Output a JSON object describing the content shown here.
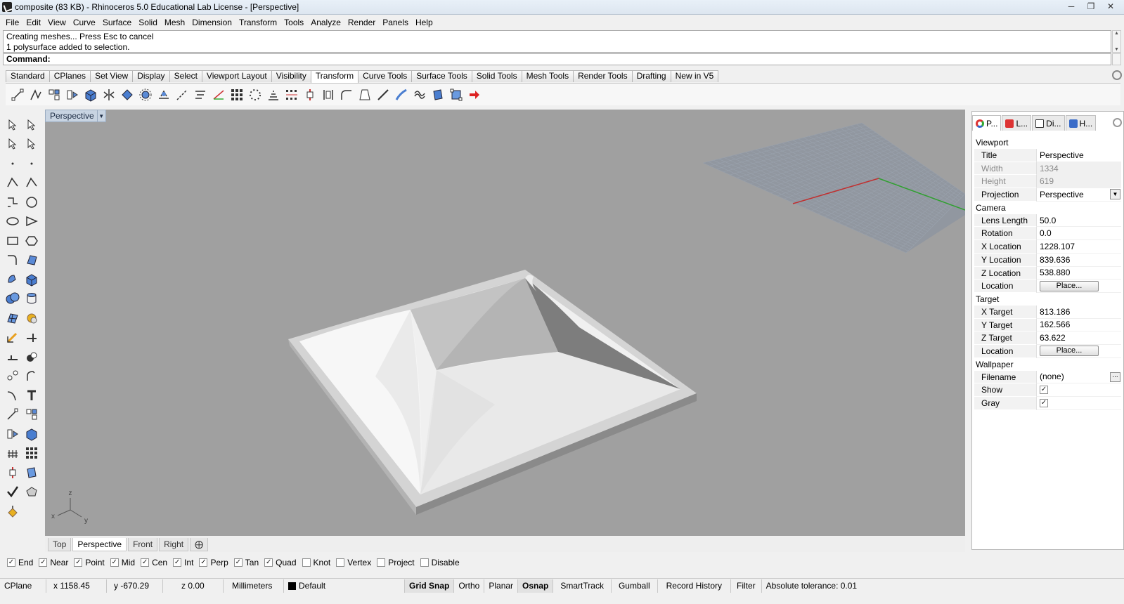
{
  "window": {
    "title": "composite (83 KB) - Rhinoceros 5.0 Educational Lab License - [Perspective]",
    "controls": [
      "minimize-icon",
      "maximize-icon",
      "close-icon"
    ]
  },
  "menu": [
    "File",
    "Edit",
    "View",
    "Curve",
    "Surface",
    "Solid",
    "Mesh",
    "Dimension",
    "Transform",
    "Tools",
    "Analyze",
    "Render",
    "Panels",
    "Help"
  ],
  "command": {
    "history": [
      "Creating meshes... Press Esc to cancel",
      "1 polysurface added to selection."
    ],
    "prompt": "Command:"
  },
  "toolbar_tabs": {
    "items": [
      "Standard",
      "CPlanes",
      "Set View",
      "Display",
      "Select",
      "Viewport Layout",
      "Visibility",
      "Transform",
      "Curve Tools",
      "Surface Tools",
      "Solid Tools",
      "Mesh Tools",
      "Render Tools",
      "Drafting",
      "New in V5"
    ],
    "active": "Transform"
  },
  "viewport": {
    "name": "Perspective",
    "axis_labels": {
      "x": "x",
      "y": "y",
      "z": "z"
    },
    "tabs": [
      "Top",
      "Perspective",
      "Front",
      "Right"
    ],
    "active_tab": "Perspective",
    "background": "#a0a0a0"
  },
  "osnap": [
    {
      "label": "End",
      "checked": true
    },
    {
      "label": "Near",
      "checked": true
    },
    {
      "label": "Point",
      "checked": true
    },
    {
      "label": "Mid",
      "checked": true
    },
    {
      "label": "Cen",
      "checked": true
    },
    {
      "label": "Int",
      "checked": true
    },
    {
      "label": "Perp",
      "checked": true
    },
    {
      "label": "Tan",
      "checked": true
    },
    {
      "label": "Quad",
      "checked": true
    },
    {
      "label": "Knot",
      "checked": false
    },
    {
      "label": "Vertex",
      "checked": false
    },
    {
      "label": "Project",
      "checked": false
    },
    {
      "label": "Disable",
      "checked": false
    }
  ],
  "status": {
    "cplane": "CPlane",
    "x": "x 1158.45",
    "y": "y -670.29",
    "z": "z 0.00",
    "units": "Millimeters",
    "layer": "Default",
    "grid_snap": "Grid Snap",
    "ortho": "Ortho",
    "planar": "Planar",
    "osnap": "Osnap",
    "smarttrack": "SmartTrack",
    "gumball": "Gumball",
    "record_history": "Record History",
    "filter": "Filter",
    "tolerance": "Absolute tolerance: 0.01"
  },
  "panel": {
    "tabs": [
      "P...",
      "L...",
      "Di...",
      "H..."
    ],
    "viewport_section": "Viewport",
    "title_label": "Title",
    "title_value": "Perspective",
    "width_label": "Width",
    "width_value": "1334",
    "height_label": "Height",
    "height_value": "619",
    "projection_label": "Projection",
    "projection_value": "Perspective",
    "camera_section": "Camera",
    "lens_label": "Lens Length",
    "lens_value": "50.0",
    "rotation_label": "Rotation",
    "rotation_value": "0.0",
    "xloc_label": "X Location",
    "xloc_value": "1228.107",
    "yloc_label": "Y Location",
    "yloc_value": "839.636",
    "zloc_label": "Z Location",
    "zloc_value": "538.880",
    "loc_label": "Location",
    "place_label": "Place...",
    "target_section": "Target",
    "xt_label": "X Target",
    "xt_value": "813.186",
    "yt_label": "Y Target",
    "yt_value": "162.566",
    "zt_label": "Z Target",
    "zt_value": "63.622",
    "wallpaper_section": "Wallpaper",
    "filename_label": "Filename",
    "filename_value": "(none)",
    "browse_label": "...",
    "show_label": "Show",
    "gray_label": "Gray"
  }
}
